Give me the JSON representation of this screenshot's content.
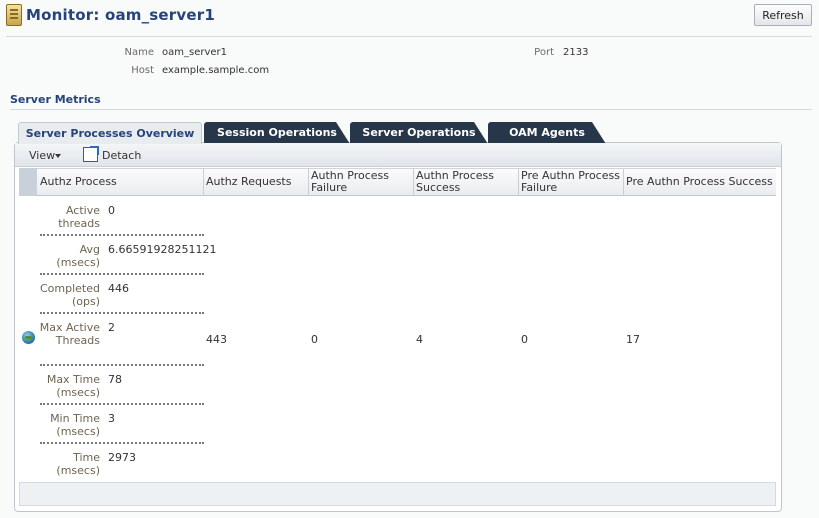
{
  "header": {
    "title": "Monitor: oam_server1",
    "refresh_label": "Refresh"
  },
  "server_info": {
    "name_label": "Name",
    "name_value": "oam_server1",
    "host_label": "Host",
    "host_value": "example.sample.com",
    "port_label": "Port",
    "port_value": "2133"
  },
  "section": {
    "title": "Server Metrics"
  },
  "tabs": [
    {
      "label": "Server Processes Overview",
      "active": true
    },
    {
      "label": "Session Operations",
      "active": false
    },
    {
      "label": "Server Operations",
      "active": false
    },
    {
      "label": "OAM Agents",
      "active": false
    }
  ],
  "toolbar": {
    "view_label": "View",
    "detach_label": "Detach"
  },
  "table": {
    "columns": [
      "Authz Process",
      "Authz Requests",
      "Authn Process Failure",
      "Authn Process Success",
      "Pre Authn Process Failure",
      "Pre Authn Process Success"
    ],
    "authz_metrics": [
      {
        "label": "Active threads",
        "value": "0"
      },
      {
        "label": "Avg (msecs)",
        "value": "6.66591928251121"
      },
      {
        "label": "Completed (ops)",
        "value": "446"
      },
      {
        "label": "Max Active Threads",
        "value": "2"
      },
      {
        "label": "Max Time (msecs)",
        "value": "78"
      },
      {
        "label": "Min Time (msecs)",
        "value": "3"
      },
      {
        "label": "Time (msecs)",
        "value": "2973"
      }
    ],
    "row_values": {
      "authz_requests": "443",
      "authn_failure": "0",
      "authn_success": "4",
      "pre_authn_failure": "0",
      "pre_authn_success": "17"
    }
  },
  "colors": {
    "title": "#26437a",
    "tab_dark": "#28364a",
    "accent_label": "#6e6450"
  },
  "icons": [
    "monitor-icon",
    "detach-icon",
    "globe-icon",
    "chevron-down-icon"
  ]
}
